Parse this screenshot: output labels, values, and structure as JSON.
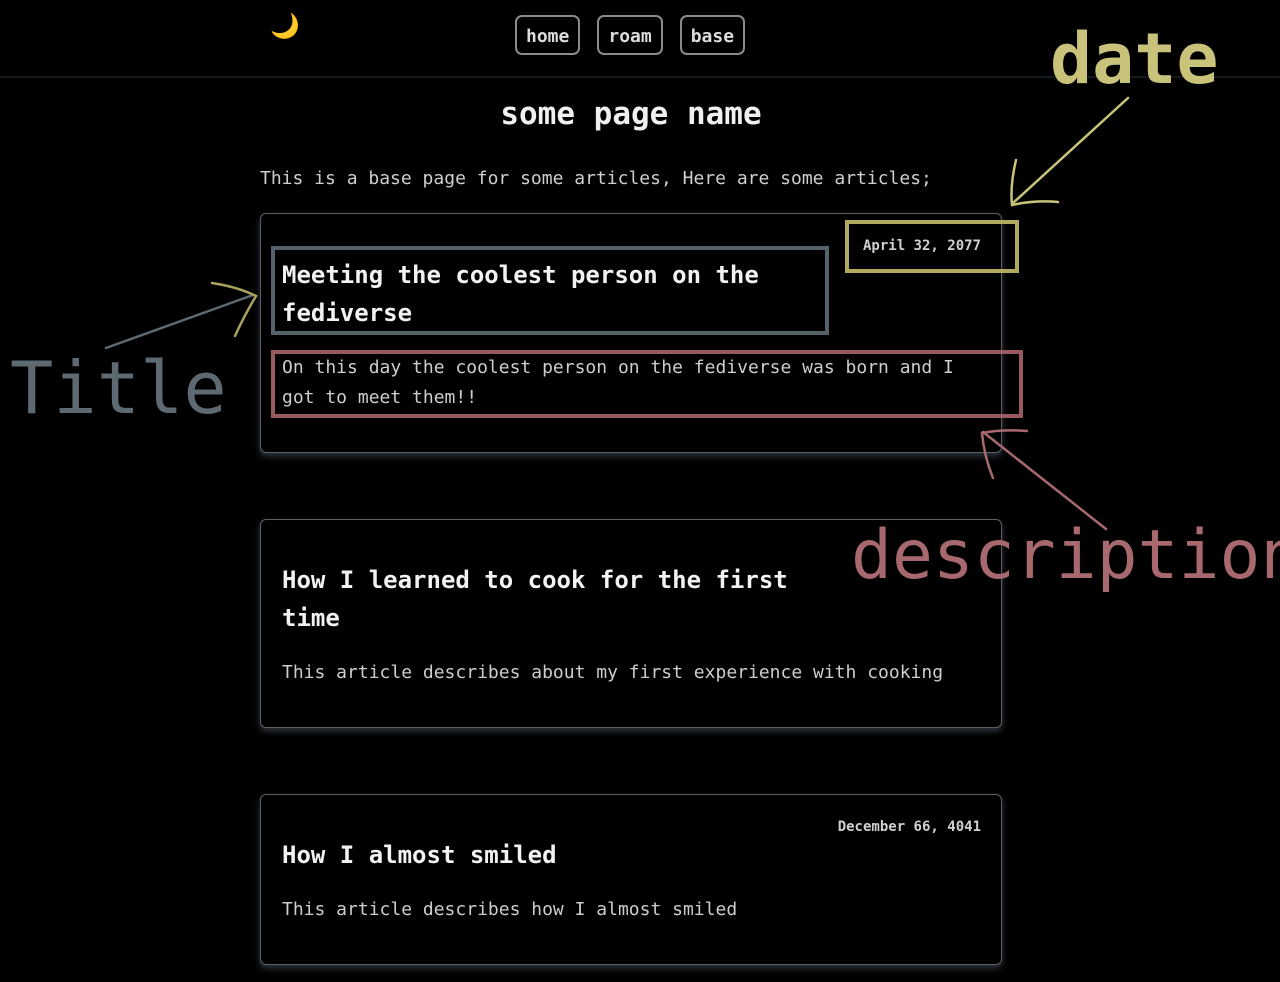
{
  "header": {
    "theme_toggle_icon": "crescent-moon-icon",
    "theme_toggle_glyph": "🌙",
    "nav": [
      {
        "label": "home"
      },
      {
        "label": "roam"
      },
      {
        "label": "base"
      }
    ]
  },
  "main": {
    "page_title": "some page name",
    "intro": "This is a base page for some articles, Here are some articles;"
  },
  "articles": [
    {
      "date": "April 32, 2077",
      "title": "Meeting the coolest person on the fediverse",
      "description": "On this day the coolest person on the fediverse was born and I got to meet them!!"
    },
    {
      "date": "",
      "title": "How I learned to cook for the first time",
      "description": "This article describes about my first experience with cooking"
    },
    {
      "date": "December 66, 4041",
      "title": "How I almost smiled",
      "description": "This article describes how I almost smiled"
    }
  ],
  "annotations": {
    "date": {
      "label": "date",
      "color": "#c8c27a"
    },
    "title": {
      "label": "Title",
      "color": "#5d6a72"
    },
    "description": {
      "label": "description",
      "color": "#a8696e"
    }
  },
  "colors": {
    "background": "#000000",
    "moon": "#f4d36b",
    "date_annotation": "#c8c27a",
    "title_annotation": "#5d6a72",
    "description_annotation": "#a8696e"
  }
}
